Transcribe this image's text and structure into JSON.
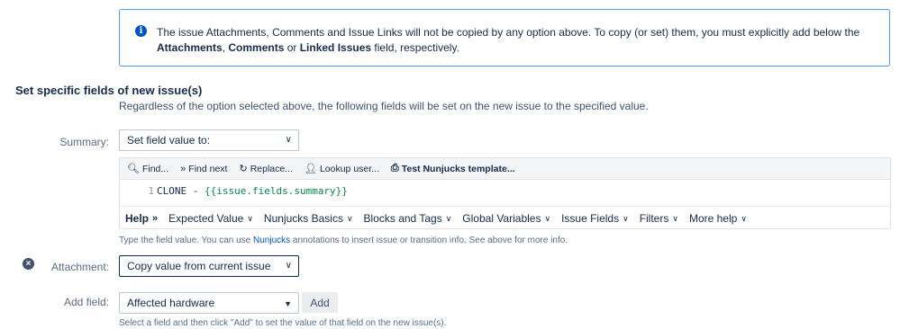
{
  "info": {
    "icon": "info-icon",
    "text_before": "The issue Attachments, Comments and Issue Links will not be copied by any option above. To copy (or set) them, you must explicitly add below the ",
    "attachments": "Attachments",
    "sep1": ", ",
    "comments": "Comments",
    "sep2": " or ",
    "linked_issues": "Linked Issues",
    "text_after": " field, respectively."
  },
  "section": {
    "title": "Set specific fields of new issue(s)",
    "description": "Regardless of the option selected above, the following fields will be set on the new issue to the specified value."
  },
  "summary": {
    "label": "Summary:",
    "select_value": "Set field value to:"
  },
  "editor": {
    "toolbar": {
      "find": "Find...",
      "find_next": "Find next",
      "replace": "Replace...",
      "lookup_user": "Lookup user...",
      "test_template": "Test Nunjucks template..."
    },
    "line_number": "1",
    "code_prefix": "CLONE - ",
    "code_template": "{{issue.fields.summary}}",
    "help_label": "Help",
    "help_items": [
      "Expected Value",
      "Nunjucks Basics",
      "Blocks and Tags",
      "Global Variables",
      "Issue Fields",
      "Filters",
      "More help"
    ]
  },
  "summary_hint": {
    "before": "Type the field value. You can use ",
    "link": "Nunjucks",
    "after": " annotations to insert issue or transition info. See above for more info."
  },
  "attachment": {
    "label": "Attachment:",
    "select_value": "Copy value from current issue",
    "remove_icon": "remove-circle-icon"
  },
  "add_field": {
    "label": "Add field:",
    "select_value": "Affected hardware",
    "button": "Add",
    "hint": "Select a field and then click \"Add\" to set the value of that field on the new issue(s)."
  },
  "colors": {
    "info_border": "#4c9aff",
    "info_icon": "#0052cc",
    "link": "#0052cc",
    "template_green": "#0a8a4a"
  }
}
